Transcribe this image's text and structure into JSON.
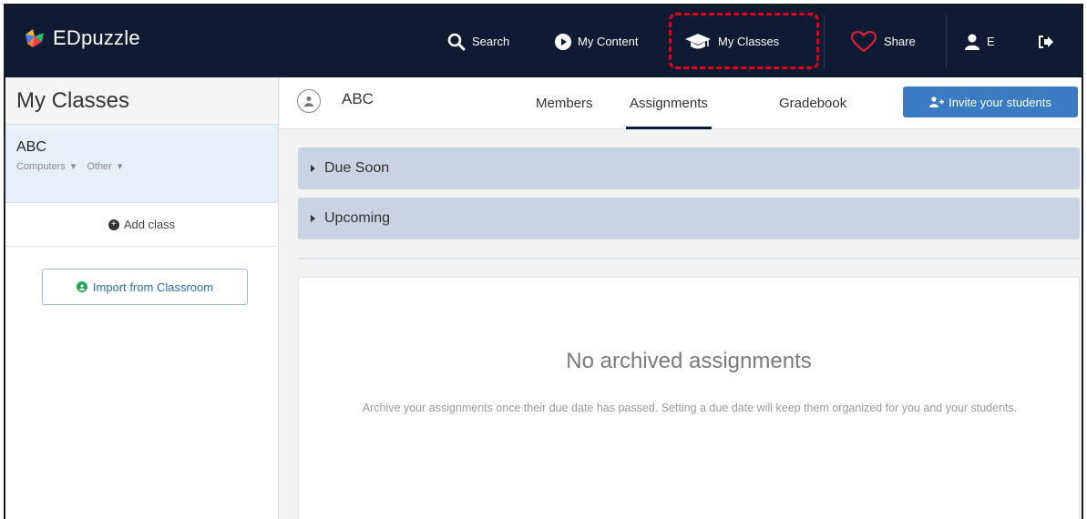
{
  "app": {
    "logo_text": "EDpuzzle"
  },
  "nav": {
    "search": "Search",
    "my_content": "My Content",
    "my_classes": "My Classes",
    "share": "Share",
    "user_initial": "E"
  },
  "sidebar": {
    "title": "My Classes",
    "classes": [
      {
        "name": "ABC",
        "subject": "Computers",
        "grade": "Other"
      }
    ],
    "add_class": "Add class",
    "import_label": "Import from Classroom"
  },
  "main": {
    "class_name": "ABC",
    "tabs": [
      {
        "label": "Members"
      },
      {
        "label": "Assignments",
        "active": true
      },
      {
        "label": "Gradebook"
      }
    ],
    "invite_label": "Invite your students",
    "sections": [
      {
        "label": "Due Soon"
      },
      {
        "label": "Upcoming"
      }
    ],
    "empty": {
      "title": "No archived assignments",
      "description": "Archive your assignments once their due date has passed. Setting a due date will keep them organized for you and your students."
    }
  },
  "colors": {
    "nav_bg": "#0f1b33",
    "highlight": "#e3001b",
    "invite_btn": "#3a7bc4",
    "section_bar": "#c8d3e3",
    "active_class_bg": "#e6f0fa",
    "share_heart": "#d6203a"
  }
}
